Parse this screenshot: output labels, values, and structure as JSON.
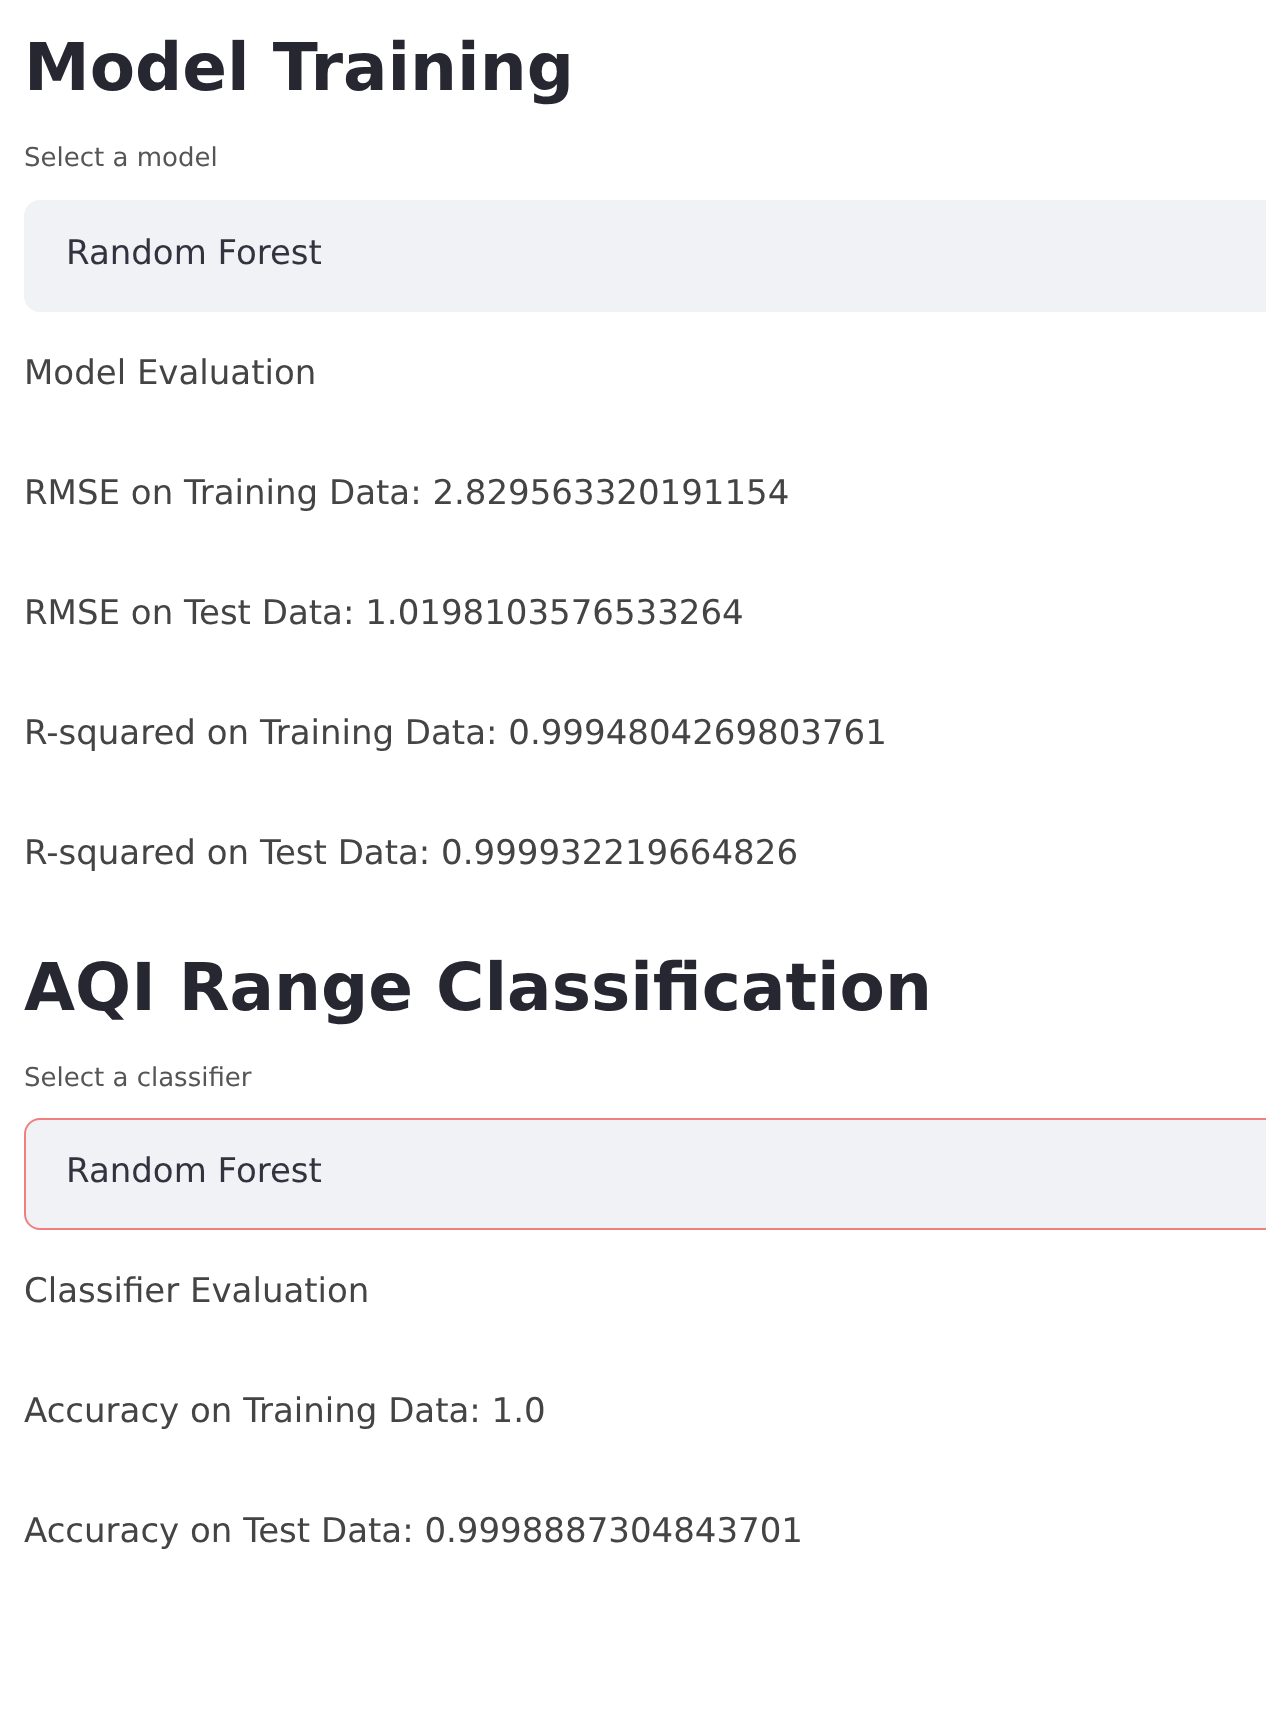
{
  "sections": [
    {
      "title": "Model Training",
      "select": {
        "label": "Select a model",
        "value": "Random Forest",
        "focused": false
      },
      "lines": [
        "Model Evaluation",
        "RMSE on Training Data: 2.829563320191154",
        "RMSE on Test Data: 1.0198103576533264",
        "R-squared on Training Data: 0.9994804269803761",
        "R-squared on Test Data: 0.999932219664826"
      ]
    },
    {
      "title": "AQI Range Classification",
      "select": {
        "label": "Select a classifier",
        "value": "Random Forest",
        "focused": true
      },
      "lines": [
        "Classifier Evaluation",
        "Accuracy on Training Data: 1.0",
        "Accuracy on Test Data: 0.9998887304843701"
      ]
    }
  ]
}
